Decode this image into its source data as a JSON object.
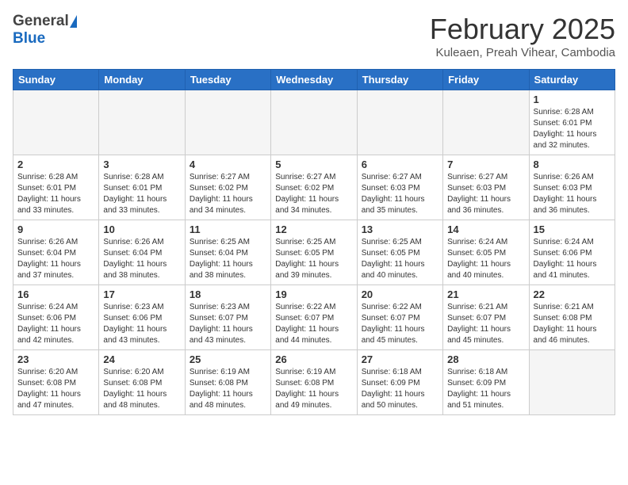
{
  "header": {
    "logo_general": "General",
    "logo_blue": "Blue",
    "month_title": "February 2025",
    "subtitle": "Kuleaen, Preah Vihear, Cambodia"
  },
  "weekdays": [
    "Sunday",
    "Monday",
    "Tuesday",
    "Wednesday",
    "Thursday",
    "Friday",
    "Saturday"
  ],
  "weeks": [
    [
      {
        "day": "",
        "info": ""
      },
      {
        "day": "",
        "info": ""
      },
      {
        "day": "",
        "info": ""
      },
      {
        "day": "",
        "info": ""
      },
      {
        "day": "",
        "info": ""
      },
      {
        "day": "",
        "info": ""
      },
      {
        "day": "1",
        "info": "Sunrise: 6:28 AM\nSunset: 6:01 PM\nDaylight: 11 hours and 32 minutes."
      }
    ],
    [
      {
        "day": "2",
        "info": "Sunrise: 6:28 AM\nSunset: 6:01 PM\nDaylight: 11 hours and 33 minutes."
      },
      {
        "day": "3",
        "info": "Sunrise: 6:28 AM\nSunset: 6:01 PM\nDaylight: 11 hours and 33 minutes."
      },
      {
        "day": "4",
        "info": "Sunrise: 6:27 AM\nSunset: 6:02 PM\nDaylight: 11 hours and 34 minutes."
      },
      {
        "day": "5",
        "info": "Sunrise: 6:27 AM\nSunset: 6:02 PM\nDaylight: 11 hours and 34 minutes."
      },
      {
        "day": "6",
        "info": "Sunrise: 6:27 AM\nSunset: 6:03 PM\nDaylight: 11 hours and 35 minutes."
      },
      {
        "day": "7",
        "info": "Sunrise: 6:27 AM\nSunset: 6:03 PM\nDaylight: 11 hours and 36 minutes."
      },
      {
        "day": "8",
        "info": "Sunrise: 6:26 AM\nSunset: 6:03 PM\nDaylight: 11 hours and 36 minutes."
      }
    ],
    [
      {
        "day": "9",
        "info": "Sunrise: 6:26 AM\nSunset: 6:04 PM\nDaylight: 11 hours and 37 minutes."
      },
      {
        "day": "10",
        "info": "Sunrise: 6:26 AM\nSunset: 6:04 PM\nDaylight: 11 hours and 38 minutes."
      },
      {
        "day": "11",
        "info": "Sunrise: 6:25 AM\nSunset: 6:04 PM\nDaylight: 11 hours and 38 minutes."
      },
      {
        "day": "12",
        "info": "Sunrise: 6:25 AM\nSunset: 6:05 PM\nDaylight: 11 hours and 39 minutes."
      },
      {
        "day": "13",
        "info": "Sunrise: 6:25 AM\nSunset: 6:05 PM\nDaylight: 11 hours and 40 minutes."
      },
      {
        "day": "14",
        "info": "Sunrise: 6:24 AM\nSunset: 6:05 PM\nDaylight: 11 hours and 40 minutes."
      },
      {
        "day": "15",
        "info": "Sunrise: 6:24 AM\nSunset: 6:06 PM\nDaylight: 11 hours and 41 minutes."
      }
    ],
    [
      {
        "day": "16",
        "info": "Sunrise: 6:24 AM\nSunset: 6:06 PM\nDaylight: 11 hours and 42 minutes."
      },
      {
        "day": "17",
        "info": "Sunrise: 6:23 AM\nSunset: 6:06 PM\nDaylight: 11 hours and 43 minutes."
      },
      {
        "day": "18",
        "info": "Sunrise: 6:23 AM\nSunset: 6:07 PM\nDaylight: 11 hours and 43 minutes."
      },
      {
        "day": "19",
        "info": "Sunrise: 6:22 AM\nSunset: 6:07 PM\nDaylight: 11 hours and 44 minutes."
      },
      {
        "day": "20",
        "info": "Sunrise: 6:22 AM\nSunset: 6:07 PM\nDaylight: 11 hours and 45 minutes."
      },
      {
        "day": "21",
        "info": "Sunrise: 6:21 AM\nSunset: 6:07 PM\nDaylight: 11 hours and 45 minutes."
      },
      {
        "day": "22",
        "info": "Sunrise: 6:21 AM\nSunset: 6:08 PM\nDaylight: 11 hours and 46 minutes."
      }
    ],
    [
      {
        "day": "23",
        "info": "Sunrise: 6:20 AM\nSunset: 6:08 PM\nDaylight: 11 hours and 47 minutes."
      },
      {
        "day": "24",
        "info": "Sunrise: 6:20 AM\nSunset: 6:08 PM\nDaylight: 11 hours and 48 minutes."
      },
      {
        "day": "25",
        "info": "Sunrise: 6:19 AM\nSunset: 6:08 PM\nDaylight: 11 hours and 48 minutes."
      },
      {
        "day": "26",
        "info": "Sunrise: 6:19 AM\nSunset: 6:08 PM\nDaylight: 11 hours and 49 minutes."
      },
      {
        "day": "27",
        "info": "Sunrise: 6:18 AM\nSunset: 6:09 PM\nDaylight: 11 hours and 50 minutes."
      },
      {
        "day": "28",
        "info": "Sunrise: 6:18 AM\nSunset: 6:09 PM\nDaylight: 11 hours and 51 minutes."
      },
      {
        "day": "",
        "info": ""
      }
    ]
  ]
}
